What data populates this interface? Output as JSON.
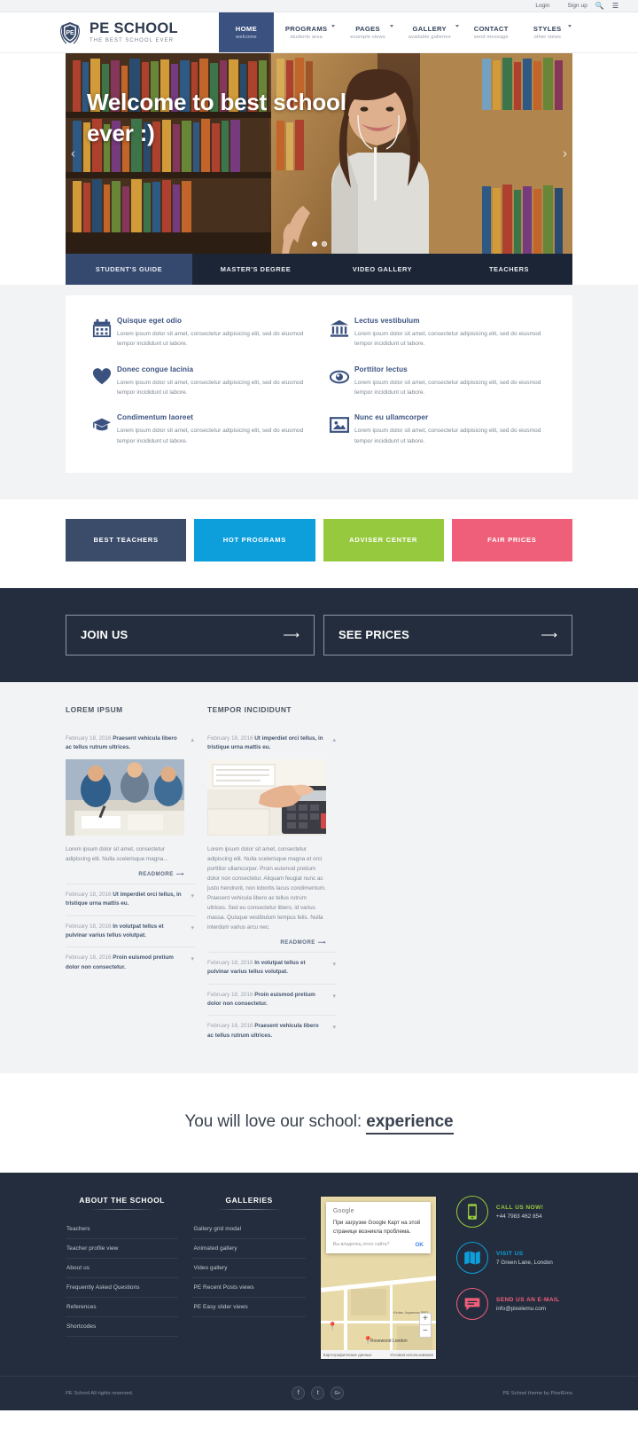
{
  "topbar": {
    "login": "Login",
    "signup": "Sign up",
    "search_icon": "search-icon",
    "menu_icon": "hamburger-menu-icon"
  },
  "brand": {
    "name": "PE SCHOOL",
    "tagline": "THE BEST SCHOOL EVER",
    "crest_letters": "PE"
  },
  "nav": [
    {
      "label": "HOME",
      "sub": "welcome",
      "active": true,
      "caret": false
    },
    {
      "label": "PROGRAMS",
      "sub": "students area",
      "active": false,
      "caret": true
    },
    {
      "label": "PAGES",
      "sub": "example views",
      "active": false,
      "caret": true
    },
    {
      "label": "GALLERY",
      "sub": "available galleries",
      "active": false,
      "caret": true
    },
    {
      "label": "CONTACT",
      "sub": "send message",
      "active": false,
      "caret": false
    },
    {
      "label": "STYLES",
      "sub": "other views",
      "active": false,
      "caret": true
    }
  ],
  "slider": {
    "caption": "Welcome to best school ever :)",
    "dots": 2,
    "active_dot": 1,
    "prev_icon": "chevron-left-icon",
    "next_icon": "chevron-right-icon"
  },
  "tabs": [
    {
      "label": "STUDENT'S GUIDE",
      "active": true
    },
    {
      "label": "MASTER'S DEGREE",
      "active": false
    },
    {
      "label": "VIDEO GALLERY",
      "active": false
    },
    {
      "label": "TEACHERS",
      "active": false
    }
  ],
  "features": [
    {
      "icon": "calendar-icon",
      "title": "Quisque eget odio",
      "text": "Lorem ipsum dolor sit amet, consectetur adipisicing elit, sed do eiusmod tempor incididunt ut labore."
    },
    {
      "icon": "bank-icon",
      "title": "Lectus vestibulum",
      "text": "Lorem ipsum dolor sit amet, consectetur adipisicing elit, sed do eiusmod tempor incididunt ut labore."
    },
    {
      "icon": "heart-icon",
      "title": "Donec congue lacinia",
      "text": "Lorem ipsum dolor sit amet, consectetur adipisicing elit, sed do eiusmod tempor incididunt ut labore."
    },
    {
      "icon": "eye-icon",
      "title": "Porttitor lectus",
      "text": "Lorem ipsum dolor sit amet, consectetur adipisicing elit, sed do eiusmod tempor incididunt ut labore."
    },
    {
      "icon": "graduation-cap-icon",
      "title": "Condimentum laoreet",
      "text": "Lorem ipsum dolor sit amet, consectetur adipisicing elit, sed do eiusmod tempor incididunt ut labore."
    },
    {
      "icon": "image-icon",
      "title": "Nunc eu ullamcorper",
      "text": "Lorem ipsum dolor sit amet, consectetur adipisicing elit, sed do eiusmod tempor incididunt ut labore."
    }
  ],
  "boxes": [
    {
      "label": "BEST TEACHERS",
      "color": "#3b4c6b"
    },
    {
      "label": "HOT PROGRAMS",
      "color": "#0d9fdc"
    },
    {
      "label": "ADVISER CENTER",
      "color": "#96c93d"
    },
    {
      "label": "FAIR PRICES",
      "color": "#ef5f79"
    }
  ],
  "cta": [
    {
      "label": "JOIN US",
      "arrow": "arrow-right-icon"
    },
    {
      "label": "SEE PRICES",
      "arrow": "arrow-right-icon"
    }
  ],
  "blog": {
    "left": {
      "title": "LOREM IPSUM",
      "items": [
        {
          "date": "February 18, 2016",
          "title": "Praesent vehicula libero ac tellus rutrum ultrices.",
          "open": true,
          "body": "Lorem ipsum dolor sit amet, consectetur adipiscing elit. Nulla scelerisque magna...",
          "readmore": "READMORE"
        },
        {
          "date": "February 18, 2016",
          "title": "Ut imperdiet orci tellus, in tristique urna mattis eu.",
          "open": false
        },
        {
          "date": "February 18, 2016",
          "title": "In volutpat tellus et pulvinar varius tellus volutpat.",
          "open": false
        },
        {
          "date": "February 18, 2016",
          "title": "Proin euismod pretium dolor non consectetur.",
          "open": false
        }
      ]
    },
    "right": {
      "title": "TEMPOR INCIDIDUNT",
      "items": [
        {
          "date": "February 18, 2016",
          "title": "Ut imperdiet orci tellus, in tristique urna mattis eu.",
          "open": true,
          "body": "Lorem ipsum dolor sit amet, consectetur adipiscing elit. Nulla scelerisque magna et orci porttitor ullamcorper. Proin euismod pretium dolor non consectetur. Aliquam feugiat nunc ac justo hendrerit, non lobortis lacus condimentum. Praesent vehicula libero ac tellus rutrum ultrices. Sed eu consectetur libero, id varius massa. Quisque vestibulum tempus felis. Nulla interdum varius arcu nec.",
          "readmore": "READMORE"
        },
        {
          "date": "February 18, 2016",
          "title": "In volutpat tellus et pulvinar varius tellus volutpat.",
          "open": false
        },
        {
          "date": "February 18, 2016",
          "title": "Proin euismod pretium dolor non consectetur.",
          "open": false
        },
        {
          "date": "February 18, 2016",
          "title": "Praesent vehicula libero ac tellus rutrum ultrices.",
          "open": false
        }
      ]
    }
  },
  "experience": {
    "prefix": "You will love our school: ",
    "highlight": "experience"
  },
  "footer": {
    "about": {
      "title": "ABOUT THE SCHOOL",
      "links": [
        "Teachers",
        "Teacher profile view",
        "About us",
        "Frequently Asked Questions",
        "References",
        "Shortcodes"
      ]
    },
    "galleries": {
      "title": "GALLERIES",
      "links": [
        "Gallery grid modal",
        "Animated gallery",
        "Video gallery",
        "PE Recent Posts views",
        "PE Easy slider views"
      ]
    },
    "map": {
      "dialog_brand": "Google",
      "dialog_message": "При загрузке Google Карт на этой странице возникла проблема.",
      "dialog_question": "Вы владелец этого сайта?",
      "dialog_ok": "OK",
      "zoom_in": "+",
      "zoom_out": "−",
      "attrib_left": "Картографические данные",
      "attrib_right": "Условия использования",
      "labels": [
        "Kintan Japanese BBQ",
        "Rosewood London"
      ]
    },
    "contacts": [
      {
        "icon": "mobile-phone-icon",
        "label": "CALL US NOW!",
        "value": "+44 7983 462 854",
        "color": "#96c93d"
      },
      {
        "icon": "map-icon",
        "label": "VISIT US",
        "value": "7 Green Lane, London",
        "color": "#0d9fdc"
      },
      {
        "icon": "chat-bubble-icon",
        "label": "SEND US AN E-MAIL",
        "value": "info@pixelemu.com",
        "color": "#ef5f79"
      }
    ],
    "copyright": "PE School All rights reserved.",
    "credit": "PE School theme by PixelEmu",
    "socials": [
      {
        "name": "facebook-icon",
        "glyph": "f"
      },
      {
        "name": "twitter-icon",
        "glyph": "t"
      },
      {
        "name": "google-plus-icon",
        "glyph": "G+"
      }
    ]
  }
}
